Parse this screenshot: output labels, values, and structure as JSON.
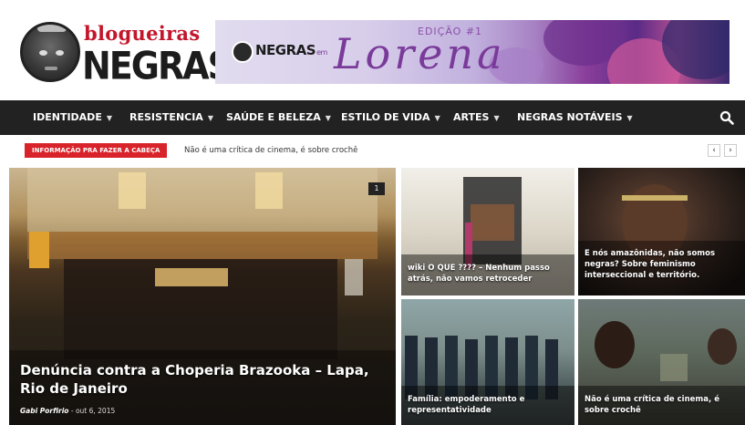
{
  "header": {
    "logo_top": "blogueiras",
    "logo_main": "NEGRAS",
    "banner": {
      "brand": "NEGRAS",
      "brand_suffix": "em",
      "edition": "EDIÇÃO #1",
      "title": "Lorena"
    }
  },
  "nav": {
    "items": [
      {
        "label": "IDENTIDADE"
      },
      {
        "label": "RESISTENCIA"
      },
      {
        "label": "SAÚDE E BELEZA"
      },
      {
        "label": "ESTILO DE VIDA"
      },
      {
        "label": "ARTES"
      },
      {
        "label": "NEGRAS NOTÁVEIS"
      }
    ],
    "search_icon": "search-icon"
  },
  "ticker": {
    "badge": "INFORMAÇÃO PRA FAZER A CABEÇA",
    "text": "Não é uma crítica de cinema, é sobre crochê",
    "prev": "‹",
    "next": "›",
    "accent": "#d8232a"
  },
  "featured": {
    "title": "Denúncia contra a Choperia Brazooka – Lapa, Rio de Janeiro",
    "author": "Gabi Porfirio",
    "separator": " - ",
    "date": "out 6, 2015",
    "comments": "1"
  },
  "posts": [
    {
      "title": "wiki O QUE ???? – Nenhum passo atrás, não vamos retroceder"
    },
    {
      "title": "E nós amazônidas, não somos negras? Sobre feminismo interseccional e território."
    },
    {
      "title": "Família: empoderamento e representatividade"
    },
    {
      "title": "Não é uma crítica de cinema, é sobre crochê"
    }
  ],
  "colors": {
    "nav_bg": "#222222",
    "brand_red": "#c3162b"
  }
}
